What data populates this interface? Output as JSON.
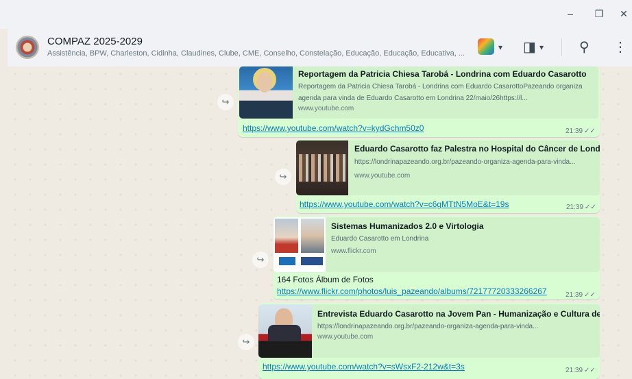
{
  "window": {
    "minimize_glyph": "–",
    "restore_glyph": "❐",
    "close_glyph": "✕"
  },
  "header": {
    "title": "COMPAZ 2025-2029",
    "members": "Assistência, BPW, Charleston, Cidinha, Claudines, Clube, CME, Conselho, Constelação, Educação, Educação, Educativa, ...",
    "icons": [
      "group-avatar",
      "app-icon",
      "chevron-down-icon",
      "video-call-icon",
      "search-icon",
      "more-vertical-icon"
    ],
    "chevron_glyph": "▾",
    "video_glyph": "◨",
    "search_glyph": "⚲",
    "menu_glyph": "⋮"
  },
  "messages": [
    {
      "preview_title": "Reportagem da Patricia Chiesa Tarobá - Londrina com Eduardo Casarotto",
      "preview_desc": "Reportagem da Patricia Chiesa Tarobá - Londrina com Eduardo CasarottoPazeando organiza agenda para vinda de Eduardo Casarotto em Londrina 22/maio/26https://l...",
      "preview_domain": "www.youtube.com",
      "link": "https://www.youtube.com/watch?v=kydGchm50z0",
      "time": "21:39"
    },
    {
      "preview_title": "Eduardo Casarotto faz Palestra no Hospital do Câncer de Londrina",
      "preview_desc": "https://londrinapazeando.org.br/pazeando-organiza-agenda-para-vinda...",
      "preview_domain": "www.youtube.com",
      "link": "https://www.youtube.com/watch?v=c6gMTtN5MoE&t=19s",
      "time": "21:39"
    },
    {
      "preview_title": "Sistemas Humanizados 2.0 e Virtologia",
      "preview_desc": "Eduardo Casarotto em Londrina",
      "preview_domain": "www.flickr.com",
      "text": "164 Fotos Álbum de Fotos",
      "link": "https://www.flickr.com/photos/luis_pazeando/albums/72177720333266267",
      "time": "21:39"
    },
    {
      "preview_title": "Entrevista Eduardo Casarotto na Jovem Pan - Humanização e Cultura de Paz",
      "preview_desc": "https://londrinapazeando.org.br/pazeando-organiza-agenda-para-vinda...",
      "preview_domain": "www.youtube.com",
      "link": "https://www.youtube.com/watch?v=sWsxF2-212w&t=3s",
      "time": "21:39"
    }
  ],
  "ticks_glyph": "✓✓",
  "forward_glyph": "↪",
  "colors": {
    "bubble": "#d9fdd3",
    "preview": "#d0f1c9",
    "link": "#027eb5",
    "chat_bg": "#efeae2",
    "header_bg": "#f0f2f5"
  }
}
